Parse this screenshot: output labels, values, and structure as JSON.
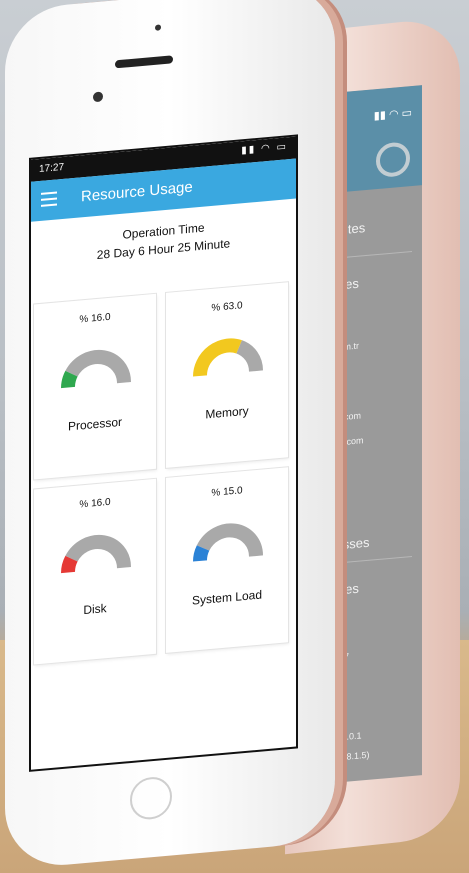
{
  "status": {
    "time": "17:27"
  },
  "app": {
    "title": "Resource Usage"
  },
  "operation": {
    "title": "Operation Time",
    "value": "28 Day  6 Hour  25 Minute"
  },
  "gauges": [
    {
      "name": "Processor",
      "percent_text": "% 16.0",
      "value": 16.0,
      "color": "#2fa84f"
    },
    {
      "name": "Memory",
      "percent_text": "% 63.0",
      "value": 63.0,
      "color": "#f2c81f"
    },
    {
      "name": "Disk",
      "percent_text": "% 16.0",
      "value": 16.0,
      "color": "#e53935"
    },
    {
      "name": "System Load",
      "percent_text": "% 15.0",
      "value": 15.0,
      "color": "#2b82d6"
    }
  ],
  "back_screen": {
    "items": [
      "ebsites",
      "Times",
      "et.com.tr",
      "rmin.com",
      "uring.com",
      "dresses",
      "Times",
      "6.1.77",
      "127.0.0.1",
      "92.168.1.5)"
    ]
  }
}
